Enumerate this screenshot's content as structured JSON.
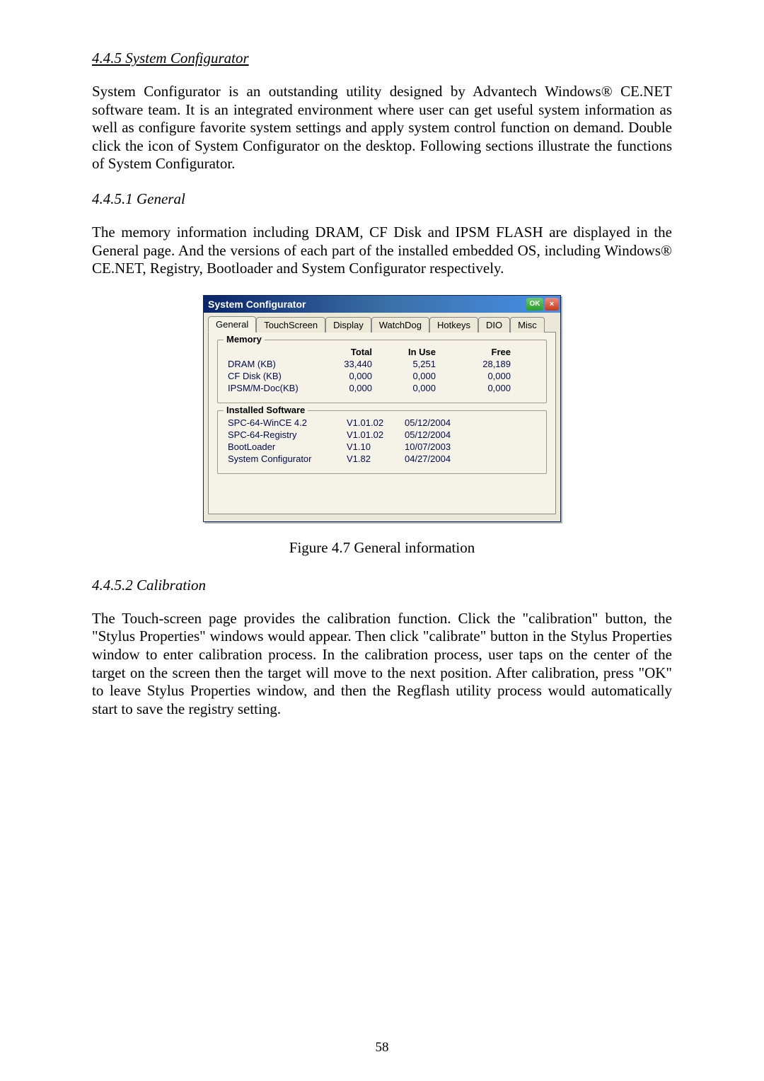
{
  "heading_445": "4.4.5 System Configurator",
  "para_445": "System Configurator is an outstanding utility designed by Advantech Windows® CE.NET software team. It is an integrated environment where user can get useful system information as well as configure favorite system settings and apply system control function on demand. Double click the icon of System Configurator on the desktop. Following sections illustrate the functions of System Configurator.",
  "heading_4451": "4.4.5.1 General",
  "para_4451": "The memory information including DRAM, CF Disk and IPSM FLASH are displayed in the General page. And the versions of each part of the installed embedded OS, including Windows® CE.NET, Registry, Bootloader and System Configurator respectively.",
  "dialog": {
    "title": "System Configurator",
    "ok": "OK",
    "close": "×",
    "tabs": [
      "General",
      "TouchScreen",
      "Display",
      "WatchDog",
      "Hotkeys",
      "DIO",
      "Misc"
    ],
    "memory": {
      "legend": "Memory",
      "headers": [
        "",
        "Total",
        "In Use",
        "Free"
      ],
      "rows": [
        {
          "label": "DRAM (KB)",
          "total": "33,440",
          "inuse": "5,251",
          "free": "28,189"
        },
        {
          "label": "CF Disk (KB)",
          "total": "0,000",
          "inuse": "0,000",
          "free": "0,000"
        },
        {
          "label": "IPSM/M-Doc(KB)",
          "total": "0,000",
          "inuse": "0,000",
          "free": "0,000"
        }
      ]
    },
    "software": {
      "legend": "Installed Software",
      "rows": [
        {
          "name": "SPC-64-WinCE 4.2",
          "ver": "V1.01.02",
          "date": "05/12/2004"
        },
        {
          "name": "SPC-64-Registry",
          "ver": "V1.01.02",
          "date": "05/12/2004"
        },
        {
          "name": "BootLoader",
          "ver": "V1.10",
          "date": "10/07/2003"
        },
        {
          "name": "System Configurator",
          "ver": "V1.82",
          "date": "04/27/2004"
        }
      ]
    }
  },
  "fig_caption": "Figure 4.7 General information",
  "heading_4452": "4.4.5.2 Calibration",
  "para_4452": "The Touch-screen page provides the calibration function. Click the \"calibration\" button, the \"Stylus Properties\" windows would appear. Then click \"calibrate\" button in the Stylus Properties window to enter calibration process. In the calibration process, user taps on the center of the target on the screen then the target will move to the next position. After calibration, press \"OK\" to leave Stylus Properties window, and then the Regflash utility process would automatically start to save the registry setting.",
  "page_num": "58"
}
